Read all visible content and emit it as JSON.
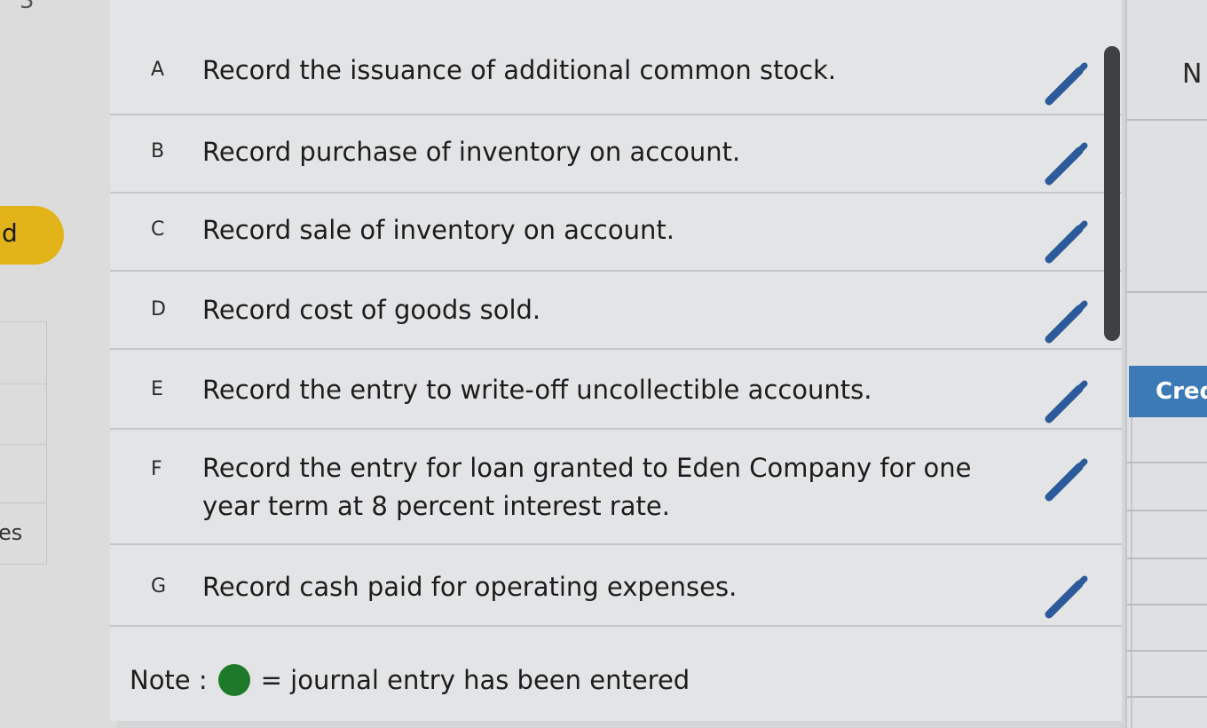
{
  "left": {
    "top_digit": "3",
    "badge_text": "d",
    "side_label": "es"
  },
  "list": {
    "items": [
      {
        "letter": "A",
        "text": "Record the issuance of additional common stock."
      },
      {
        "letter": "B",
        "text": "Record purchase of inventory on account."
      },
      {
        "letter": "C",
        "text": "Record sale of inventory on account."
      },
      {
        "letter": "D",
        "text": "Record cost of goods sold."
      },
      {
        "letter": "E",
        "text": "Record the entry to write-off uncollectible accounts."
      },
      {
        "letter": "F",
        "text": "Record the entry for loan granted to Eden Company for one year term at 8 percent interest rate."
      },
      {
        "letter": "G",
        "text": "Record cash paid for operating expenses."
      }
    ],
    "edit_icon": "pencil-icon"
  },
  "note": {
    "prefix": "Note :",
    "suffix": "= journal entry has been entered",
    "dot_color": "#1e7a2a"
  },
  "right": {
    "header_letter": "N",
    "button_label": "Cred",
    "button_color": "#3c79b7"
  }
}
